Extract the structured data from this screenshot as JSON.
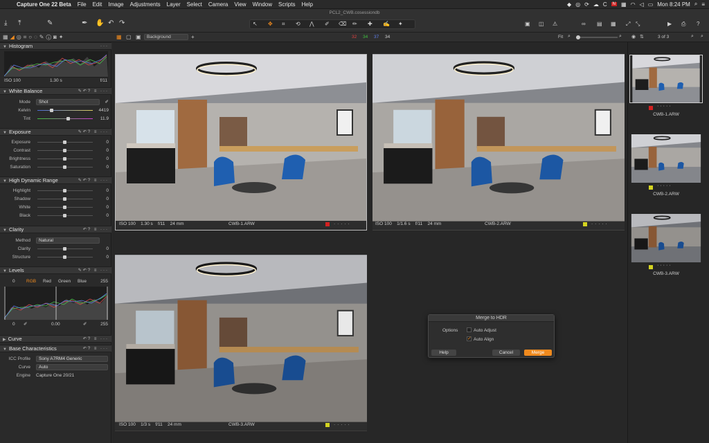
{
  "menubar": {
    "app_name": "Capture One 22 Beta",
    "items": [
      "File",
      "Edit",
      "Image",
      "Adjustments",
      "Layer",
      "Select",
      "Camera",
      "View",
      "Window",
      "Scripts",
      "Help"
    ],
    "clock": "Mon 8:24 PM"
  },
  "toolbar": {
    "document_title": "PCL2_CWB.cosessiondb",
    "counts": {
      "red": "32",
      "green": "34",
      "blue": "37",
      "gray": "34"
    }
  },
  "viewer_bar": {
    "background_select": "Background",
    "fit_label": "Fit",
    "page_count": "3 of 3"
  },
  "left_panel": {
    "histogram": {
      "title": "Histogram",
      "iso": "ISO 100",
      "shutter": "1.30 s",
      "aperture": "f/11"
    },
    "white_balance": {
      "title": "White Balance",
      "mode_label": "Mode",
      "mode_value": "Shot",
      "kelvin_label": "Kelvin",
      "kelvin_value": "4419",
      "tint_label": "Tint",
      "tint_value": "11.9"
    },
    "exposure": {
      "title": "Exposure",
      "rows": [
        {
          "label": "Exposure",
          "value": "0"
        },
        {
          "label": "Contrast",
          "value": "0"
        },
        {
          "label": "Brightness",
          "value": "0"
        },
        {
          "label": "Saturation",
          "value": "0"
        }
      ]
    },
    "hdr": {
      "title": "High Dynamic Range",
      "rows": [
        {
          "label": "Highlight",
          "value": "0"
        },
        {
          "label": "Shadow",
          "value": "0"
        },
        {
          "label": "White",
          "value": "0"
        },
        {
          "label": "Black",
          "value": "0"
        }
      ]
    },
    "clarity": {
      "title": "Clarity",
      "method_label": "Method",
      "method_value": "Natural",
      "rows": [
        {
          "label": "Clarity",
          "value": "0"
        },
        {
          "label": "Structure",
          "value": "0"
        }
      ]
    },
    "levels": {
      "title": "Levels",
      "left_val": "0",
      "right_val": "255",
      "tabs": [
        "RGB",
        "Red",
        "Green",
        "Blue"
      ],
      "bottom_left": "0",
      "mid": "0.00",
      "bottom_right": "255"
    },
    "curve": {
      "title": "Curve"
    },
    "base": {
      "title": "Base Characteristics",
      "icc_label": "ICC Profile",
      "icc_value": "Sony A7RM4 Generic",
      "curve_label": "Curve",
      "curve_value": "Auto",
      "engine_label": "Engine",
      "engine_value": "Capture One 20/21"
    }
  },
  "viewer": {
    "images": [
      {
        "iso": "ISO 100",
        "shutter": "1.30 s",
        "aperture": "f/11",
        "focal": "24 mm",
        "name": "CWB-1.ARW",
        "label_color": "#d42020"
      },
      {
        "iso": "ISO 100",
        "shutter": "1/1.6 s",
        "aperture": "f/11",
        "focal": "24 mm",
        "name": "CWB-2.ARW",
        "label_color": "#d4d420"
      },
      {
        "iso": "ISO 100",
        "shutter": "1/3 s",
        "aperture": "f/11",
        "focal": "24 mm",
        "name": "CWB-3.ARW",
        "label_color": "#d4d420"
      }
    ]
  },
  "filmstrip": {
    "items": [
      {
        "name": "CWB-1.ARW",
        "label_color": "#d42020"
      },
      {
        "name": "CWB-2.ARW",
        "label_color": "#d4d420"
      },
      {
        "name": "CWB-3.ARW",
        "label_color": "#d4d420"
      }
    ]
  },
  "dialog": {
    "title": "Merge to HDR",
    "options_label": "Options",
    "auto_adjust": "Auto Adjust",
    "auto_align": "Auto Align",
    "help": "Help",
    "cancel": "Cancel",
    "merge": "Merge",
    "accent": "#f08a1e"
  }
}
